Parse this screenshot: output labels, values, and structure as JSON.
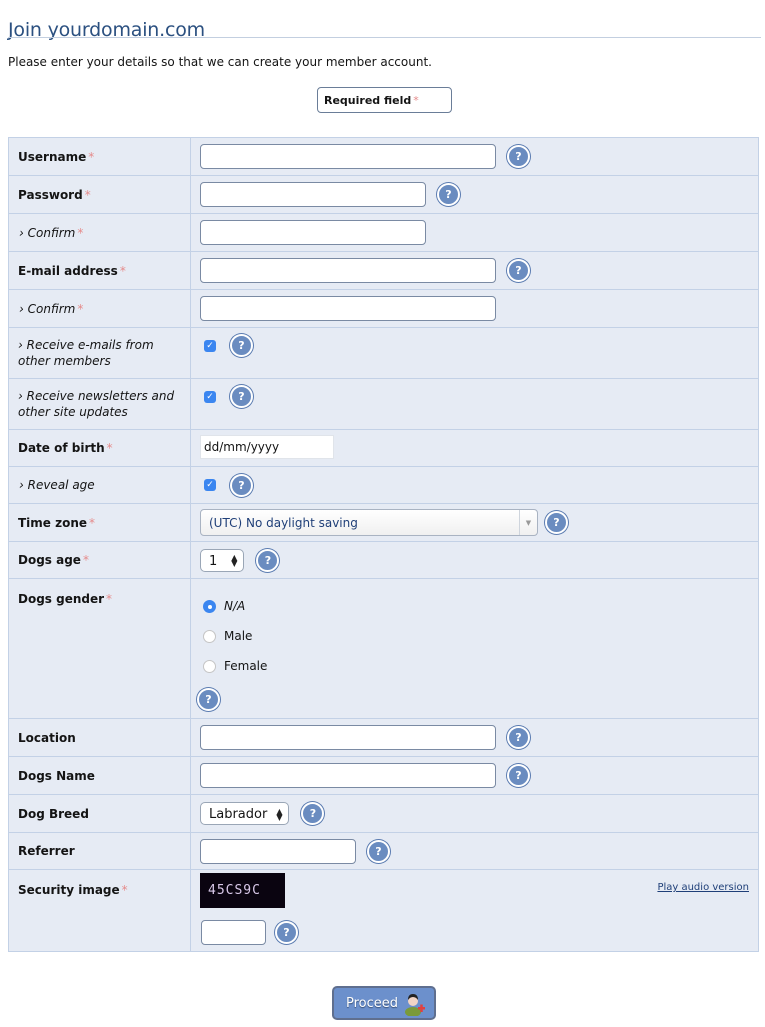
{
  "page": {
    "title": "Join yourdomain.com",
    "intro": "Please enter your details so that we can create your member account.",
    "required_legend": "Required field",
    "required_marker": "*"
  },
  "form": {
    "username": {
      "label": "Username",
      "value": ""
    },
    "password": {
      "label": "Password",
      "value": ""
    },
    "password_confirm": {
      "label": "› Confirm",
      "value": ""
    },
    "email": {
      "label": "E-mail address",
      "value": ""
    },
    "email_confirm": {
      "label": "› Confirm",
      "value": ""
    },
    "receive_member_emails": {
      "label_line1": "› Receive e-mails from",
      "label_line2": "other members",
      "checked": true
    },
    "receive_newsletters": {
      "label_line1": "› Receive newsletters and",
      "label_line2": "other site updates",
      "checked": true
    },
    "date_of_birth": {
      "label": "Date of birth",
      "placeholder": "dd/mm/yyyy"
    },
    "reveal_age": {
      "label": "› Reveal age",
      "checked": true
    },
    "time_zone": {
      "label": "Time zone",
      "selected": "(UTC) No daylight saving"
    },
    "dogs_age": {
      "label": "Dogs age",
      "selected": "1"
    },
    "dogs_gender": {
      "label": "Dogs gender",
      "options": [
        "N/A",
        "Male",
        "Female"
      ],
      "selected": "N/A"
    },
    "location": {
      "label": "Location",
      "value": ""
    },
    "dogs_name": {
      "label": "Dogs Name",
      "value": ""
    },
    "dog_breed": {
      "label": "Dog Breed",
      "selected": "Labrador"
    },
    "referrer": {
      "label": "Referrer",
      "value": ""
    },
    "security_image": {
      "label": "Security image",
      "captcha_text": "45CS9C",
      "audio_link": "Play audio version",
      "value": ""
    }
  },
  "icons": {
    "help": "?",
    "check": "✓",
    "select_arrow": "▼",
    "spin_up": "▲",
    "spin_down": "▼"
  },
  "actions": {
    "proceed_label": "Proceed"
  },
  "colors": {
    "title": "#2b5080",
    "required": "#e58a8a",
    "table_bg": "#e6ebf4",
    "border": "#c3d1e6",
    "help_icon": "#6a8cc0",
    "checkbox": "#3b86f0",
    "button": "#6c90cc"
  }
}
